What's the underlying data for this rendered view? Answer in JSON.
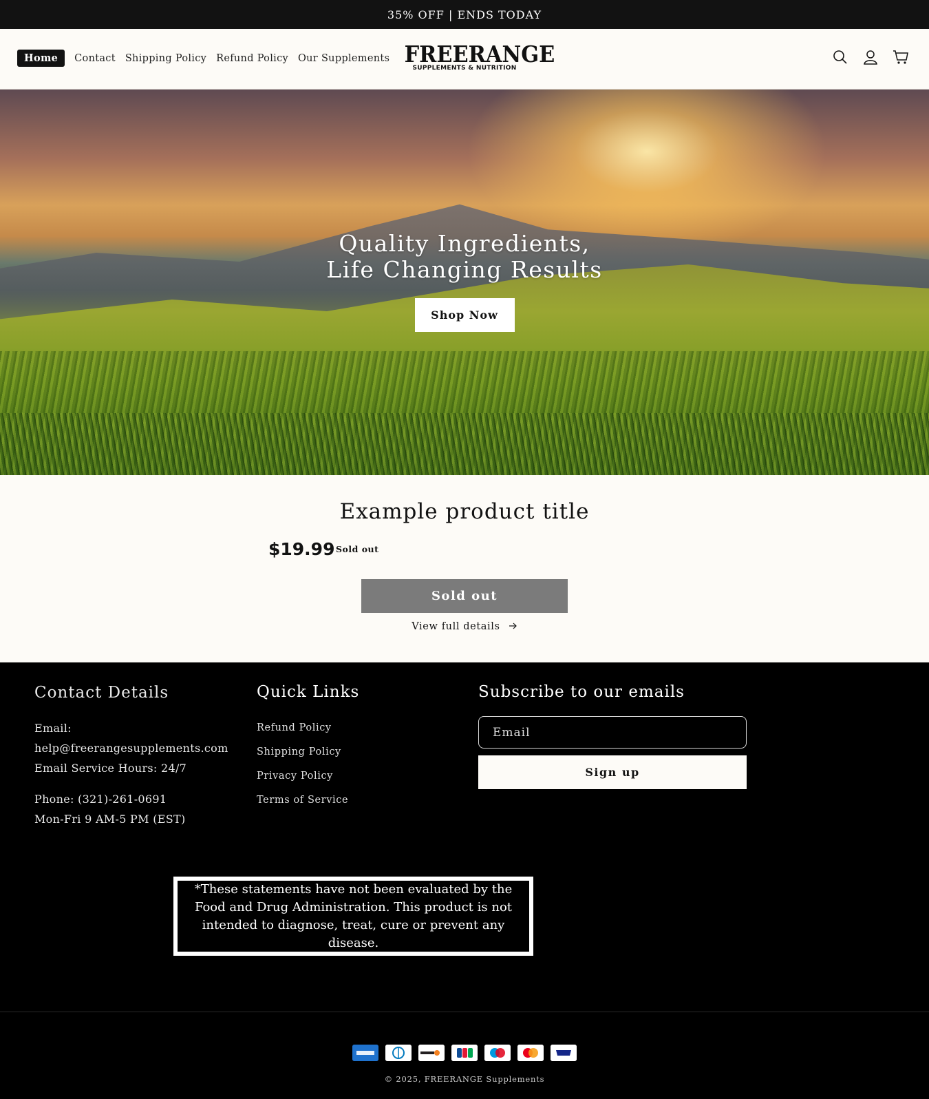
{
  "announcement": "35% OFF | ENDS TODAY",
  "nav": {
    "items": [
      {
        "label": "Home"
      },
      {
        "label": "Contact"
      },
      {
        "label": "Shipping Policy"
      },
      {
        "label": "Refund Policy"
      },
      {
        "label": "Our Supplements"
      }
    ]
  },
  "logo": {
    "line1": "FREERANGE",
    "line2": "SUPPLEMENTS & NUTRITION"
  },
  "header_icons": [
    "search-icon",
    "account-icon",
    "cart-icon"
  ],
  "hero": {
    "title": "Quality Ingredients, Life Changing Results",
    "button": "Shop Now"
  },
  "product": {
    "title": "Example product title",
    "price": "$19.99",
    "badge": "Sold out",
    "button": "Sold out",
    "details_link": "View full details"
  },
  "footer": {
    "contact": {
      "heading": "Contact Details",
      "email_label": "Email:",
      "email": "help@freerangesupplements.com",
      "email_hours": "Email Service Hours: 24/7",
      "phone": "Phone: (321)-261-0691",
      "phone_hours": "Mon-Fri 9 AM-5 PM (EST)"
    },
    "quick_links": {
      "heading": "Quick Links",
      "links": [
        "Refund Policy",
        "Shipping Policy",
        "Privacy Policy",
        "Terms of Service"
      ]
    },
    "subscribe": {
      "heading": "Subscribe to our emails",
      "placeholder": "Email",
      "button": "Sign up"
    },
    "disclaimer": "*These statements have not been evaluated by the Food and Drug Administration. This product is not intended to diagnose, treat, cure or prevent any disease.",
    "payment_icons": [
      "amex-icon",
      "diners-club-icon",
      "discover-icon",
      "jcb-icon",
      "maestro-icon",
      "mastercard-icon",
      "visa-icon"
    ],
    "copyright": "© 2025, FREERANGE Supplements"
  },
  "colors": {
    "primary": "#121212",
    "background": "#fdfbf7",
    "sold_out_button": "#7b7b7b"
  }
}
